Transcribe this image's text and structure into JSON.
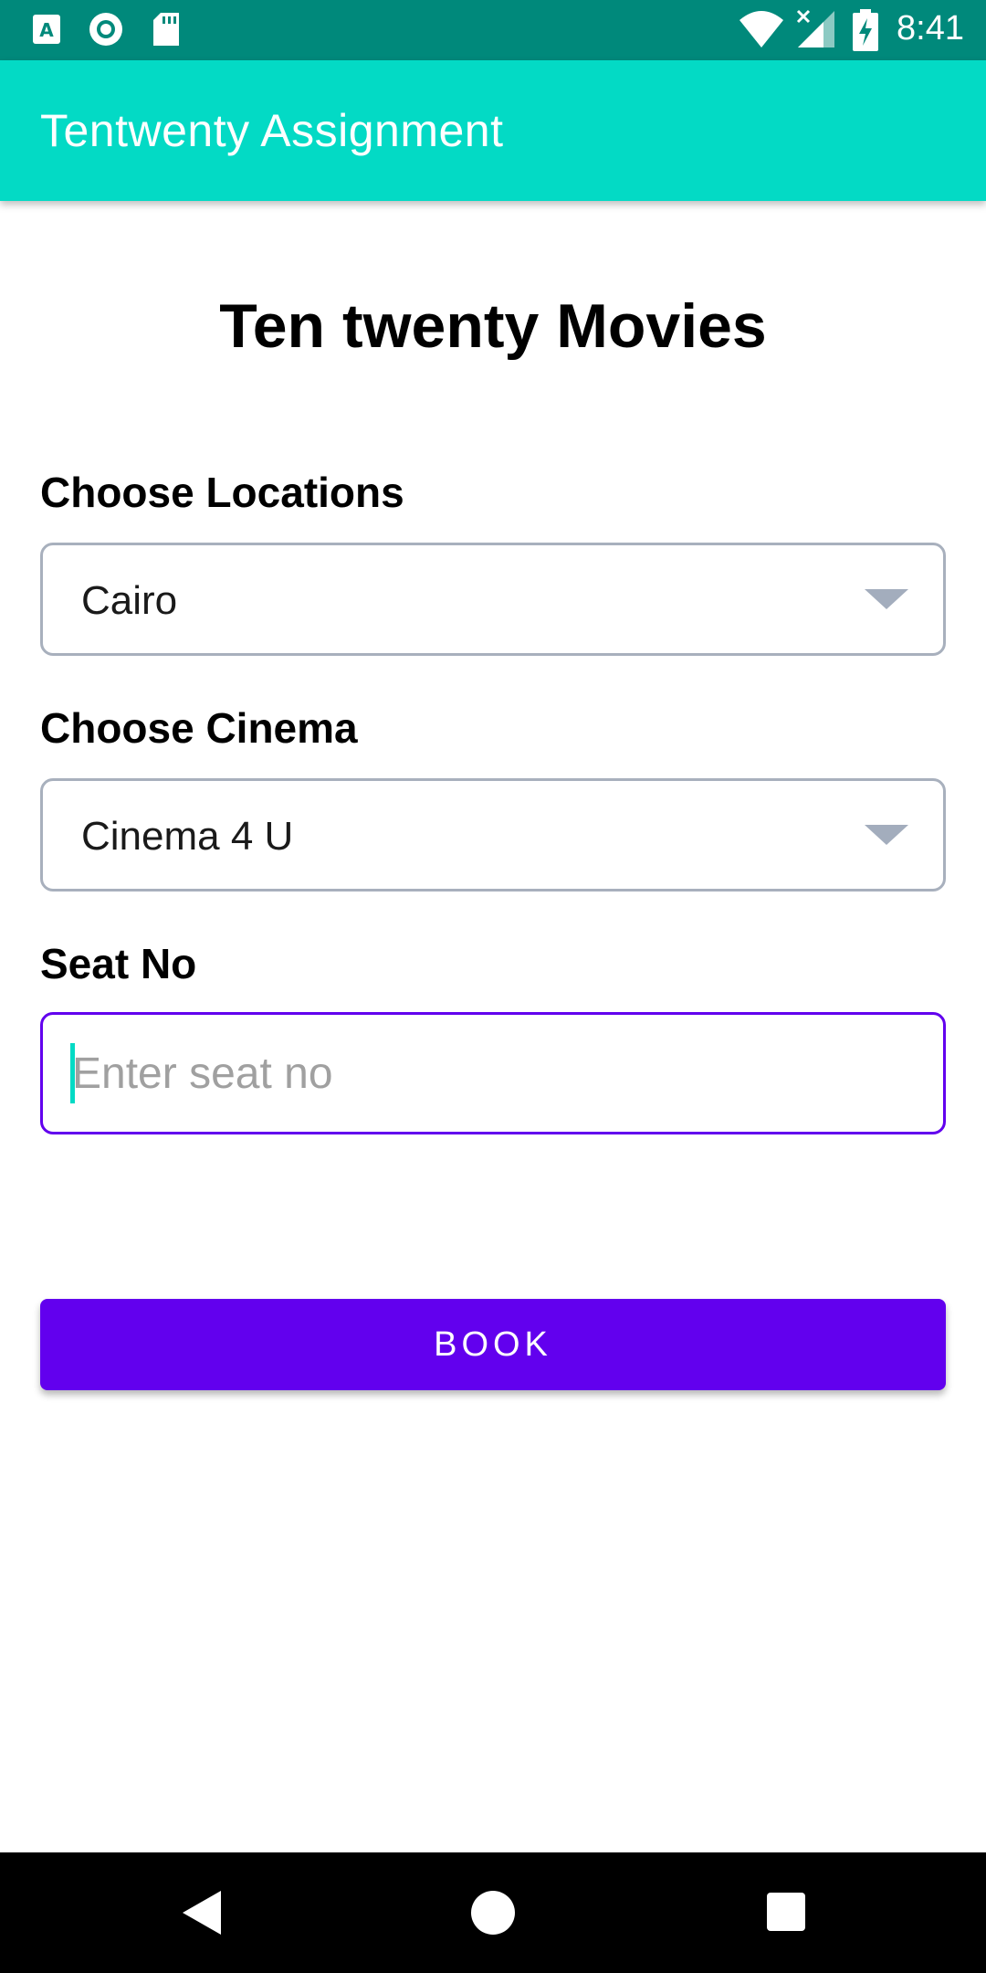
{
  "status_bar": {
    "time": "8:41",
    "left_icons": [
      "font-icon",
      "record-icon",
      "sd-card-icon"
    ],
    "right_icons": [
      "wifi-icon",
      "signal-icon",
      "battery-charging-icon"
    ]
  },
  "app_bar": {
    "title": "Tentwenty Assignment",
    "color": "#03dac5"
  },
  "main": {
    "heading": "Ten twenty Movies",
    "location": {
      "label": "Choose Locations",
      "selected": "Cairo"
    },
    "cinema": {
      "label": "Choose Cinema",
      "selected": "Cinema 4 U"
    },
    "seat": {
      "label": "Seat No",
      "placeholder": "Enter seat no",
      "value": ""
    },
    "book_label": "BOOK",
    "accent": "#6200ee"
  },
  "nav_bar": {
    "icons": [
      "back-icon",
      "home-icon",
      "recents-icon"
    ]
  }
}
